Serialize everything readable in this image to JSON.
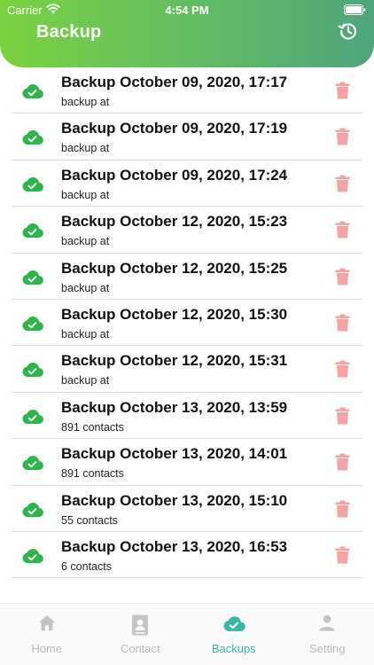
{
  "status_bar": {
    "carrier": "Carrier",
    "time": "4:54 PM"
  },
  "header": {
    "title": "Backup",
    "history_icon": "history-icon"
  },
  "colors": {
    "header_start": "#7ad23f",
    "header_end": "#4fa57c",
    "cloud_green": "#2bb54a",
    "trash_pink": "#f2a3a3",
    "tab_active": "#3bb5a8",
    "tab_inactive": "#b9b9b9"
  },
  "backups": [
    {
      "title": "Backup October 09, 2020, 17:17",
      "subtitle": "backup at"
    },
    {
      "title": "Backup October 09, 2020, 17:19",
      "subtitle": "backup at"
    },
    {
      "title": "Backup October 09, 2020, 17:24",
      "subtitle": "backup at"
    },
    {
      "title": "Backup October 12, 2020, 15:23",
      "subtitle": "backup at"
    },
    {
      "title": "Backup October 12, 2020, 15:25",
      "subtitle": "backup at"
    },
    {
      "title": "Backup October 12, 2020, 15:30",
      "subtitle": "backup at"
    },
    {
      "title": "Backup October 12, 2020, 15:31",
      "subtitle": "backup at"
    },
    {
      "title": "Backup October 13, 2020, 13:59",
      "subtitle": "891 contacts"
    },
    {
      "title": "Backup October 13, 2020, 14:01",
      "subtitle": "891 contacts"
    },
    {
      "title": "Backup October 13, 2020, 15:10",
      "subtitle": "55 contacts"
    },
    {
      "title": "Backup October 13, 2020, 16:53",
      "subtitle": "6 contacts"
    }
  ],
  "tabs": [
    {
      "label": "Home",
      "icon": "home-icon",
      "active": false
    },
    {
      "label": "Contact",
      "icon": "contact-book-icon",
      "active": false
    },
    {
      "label": "Backups",
      "icon": "cloud-check-icon",
      "active": true
    },
    {
      "label": "Setting",
      "icon": "person-icon",
      "active": false
    }
  ]
}
